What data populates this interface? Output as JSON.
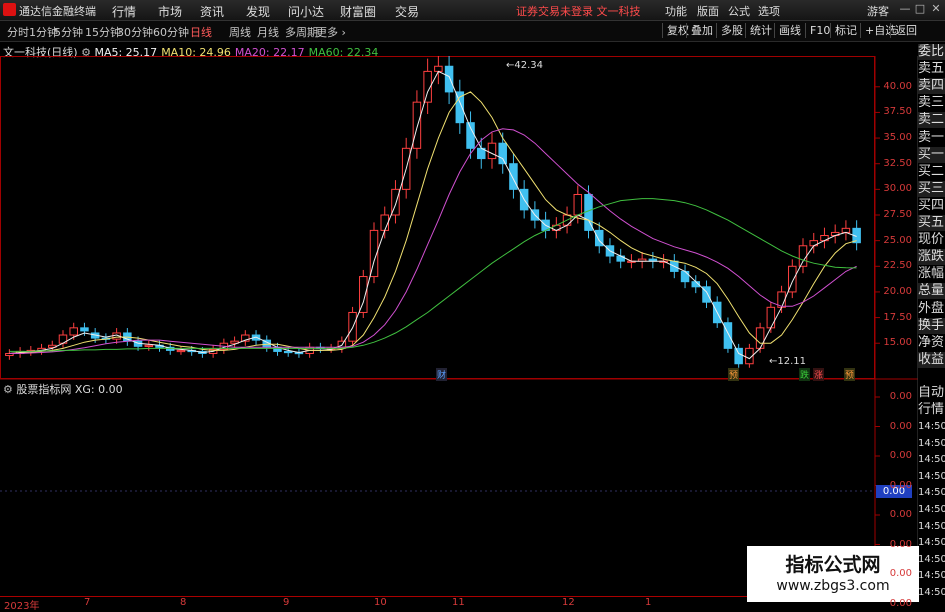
{
  "app": {
    "title": "通达信金融终端",
    "login_warning": "证券交易未登录",
    "stock_name": "文一科技",
    "menu": [
      "行情",
      "市场",
      "资讯",
      "发现",
      "问小达",
      "财富圈",
      "交易"
    ],
    "right_menu": [
      "功能",
      "版面",
      "公式",
      "选项"
    ],
    "guest": "游客",
    "window_buttons": [
      "—",
      "□",
      "✕"
    ]
  },
  "toolbar": {
    "periods": [
      {
        "label": "分时",
        "active": false
      },
      {
        "label": "1分钟",
        "active": false
      },
      {
        "label": "5分钟",
        "active": false
      },
      {
        "label": "15分钟",
        "active": false
      },
      {
        "label": "30分钟",
        "active": false
      },
      {
        "label": "60分钟",
        "active": false
      },
      {
        "label": "日线",
        "active": true
      },
      {
        "label": "周线",
        "active": false
      },
      {
        "label": "月线",
        "active": false
      },
      {
        "label": "多周期",
        "active": false
      },
      {
        "label": "更多 ›",
        "active": false
      }
    ],
    "right_tools": [
      "复权",
      "叠加",
      "多股",
      "统计",
      "画线",
      "F10",
      "标记",
      "+自选",
      "返回"
    ]
  },
  "main_chart": {
    "title": "文一科技(日线)",
    "ma": [
      {
        "label": "MA5: 25.17",
        "color": "#f0f0f0"
      },
      {
        "label": "MA10: 24.96",
        "color": "#f0e070"
      },
      {
        "label": "MA20: 22.17",
        "color": "#d050d0"
      },
      {
        "label": "MA60: 22.34",
        "color": "#40c040"
      }
    ],
    "y_ticks": [
      "40.00",
      "37.50",
      "35.00",
      "32.50",
      "30.00",
      "27.50",
      "25.00",
      "22.50",
      "20.00",
      "17.50",
      "15.00"
    ],
    "high_label": "42.34",
    "low_label": "12.11",
    "events": [
      {
        "label": "财",
        "color": "#5aa0ff"
      },
      {
        "label": "预",
        "color": "#ff9a3a"
      },
      {
        "label": "跌",
        "color": "#3ad03a"
      },
      {
        "label": "涨",
        "color": "#ff5050"
      },
      {
        "label": "预",
        "color": "#ff9a3a"
      }
    ]
  },
  "sub_chart": {
    "title": "股票指标网",
    "xg_label": "XG: 0.00",
    "y_ticks": [
      "0.00",
      "0.00",
      "0.00",
      "0.00",
      "0.00",
      "0.00",
      "0.00",
      "0.00"
    ],
    "current": "0.00"
  },
  "right_panel": {
    "items": [
      "委比",
      "卖五",
      "卖四",
      "卖三",
      "卖二",
      "卖一",
      "买一",
      "买二",
      "买三",
      "买四",
      "买五",
      "现价",
      "涨跌",
      "涨幅",
      "总量",
      "外盘",
      "换手",
      "净资",
      "收益"
    ],
    "auto_label": "自动",
    "quote_label": "行情",
    "times": [
      "14:50",
      "14:50",
      "14:50",
      "14:50",
      "14:50",
      "14:50",
      "14:50",
      "14:50",
      "14:50",
      "14:50",
      "14:50"
    ]
  },
  "x_axis": {
    "labels": [
      "2023年",
      "7",
      "8",
      "9",
      "10",
      "11",
      "12",
      "1"
    ]
  },
  "watermark": {
    "title": "指标公式网",
    "url": "www.zbgs3.com"
  },
  "colors": {
    "up": "#ff4040",
    "down": "#40c0f0",
    "ma5": "#f0f0f0",
    "ma10": "#f0e070",
    "ma20": "#d050d0",
    "ma60": "#40c040",
    "axis": "#a00000"
  },
  "chart_data": {
    "type": "candlestick",
    "title": "文一科技(日线)",
    "y_range": [
      12.0,
      43.0
    ],
    "series": [
      {
        "name": "MA5",
        "values": [
          14.0,
          14.1,
          14.2,
          14.3,
          14.5,
          15.0,
          15.6,
          16.0,
          15.8,
          15.6,
          15.8,
          15.4,
          15.0,
          14.9,
          14.8,
          14.5,
          14.4,
          14.3,
          14.1,
          14.2,
          14.6,
          14.9,
          15.3,
          15.6,
          15.1,
          14.6,
          14.3,
          14.1,
          14.3,
          14.3,
          14.4,
          14.8,
          16.5,
          19.0,
          23.0,
          26.0,
          28.5,
          32.0,
          36.0,
          39.5,
          41.5,
          41.0,
          38.5,
          36.0,
          34.0,
          33.5,
          33.0,
          31.0,
          29.0,
          27.5,
          26.5,
          26.0,
          26.5,
          27.5,
          27.0,
          25.0,
          24.0,
          23.5,
          23.0,
          23.0,
          23.0,
          23.0,
          22.5,
          22.0,
          21.0,
          20.0,
          18.0,
          16.0,
          14.0,
          13.5,
          14.5,
          16.5,
          18.5,
          21.0,
          23.0,
          24.5,
          25.0,
          25.5,
          25.8,
          25.4
        ]
      },
      {
        "name": "MA10",
        "values": [
          14.0,
          14.05,
          14.1,
          14.2,
          14.3,
          14.5,
          14.8,
          15.1,
          15.3,
          15.4,
          15.6,
          15.6,
          15.5,
          15.3,
          15.1,
          14.9,
          14.7,
          14.6,
          14.4,
          14.3,
          14.3,
          14.4,
          14.6,
          14.8,
          14.9,
          14.9,
          14.7,
          14.5,
          14.3,
          14.3,
          14.3,
          14.4,
          14.8,
          15.8,
          17.5,
          19.5,
          22.0,
          25.0,
          28.5,
          32.0,
          35.0,
          37.5,
          39.0,
          39.5,
          38.5,
          37.0,
          35.0,
          33.5,
          32.0,
          30.5,
          29.0,
          28.0,
          27.5,
          27.2,
          27.0,
          26.5,
          25.8,
          25.0,
          24.3,
          23.8,
          23.5,
          23.2,
          23.0,
          22.8,
          22.4,
          21.8,
          20.8,
          19.3,
          17.6,
          16.0,
          15.0,
          15.0,
          15.8,
          17.3,
          19.0,
          20.8,
          22.5,
          23.8,
          24.7,
          25.0
        ]
      },
      {
        "name": "MA20",
        "values": [
          14.0,
          14.0,
          14.05,
          14.1,
          14.15,
          14.25,
          14.4,
          14.55,
          14.75,
          14.95,
          15.1,
          15.2,
          15.3,
          15.3,
          15.3,
          15.2,
          15.1,
          15.0,
          14.9,
          14.8,
          14.7,
          14.6,
          14.6,
          14.6,
          14.6,
          14.6,
          14.6,
          14.6,
          14.6,
          14.6,
          14.6,
          14.6,
          14.7,
          15.1,
          15.8,
          16.8,
          18.2,
          20.0,
          22.2,
          24.6,
          27.0,
          29.5,
          31.7,
          33.5,
          34.8,
          35.6,
          35.9,
          35.8,
          35.3,
          34.5,
          33.5,
          32.5,
          31.5,
          30.5,
          29.7,
          28.8,
          27.9,
          27.1,
          26.4,
          25.8,
          25.2,
          24.8,
          24.4,
          24.1,
          23.8,
          23.4,
          22.9,
          22.3,
          21.5,
          20.6,
          19.7,
          19.0,
          18.6,
          18.6,
          19.0,
          19.6,
          20.4,
          21.2,
          22.0,
          22.5
        ]
      },
      {
        "name": "MA60",
        "values": [
          14.2,
          14.2,
          14.2,
          14.25,
          14.25,
          14.3,
          14.3,
          14.35,
          14.35,
          14.4,
          14.4,
          14.45,
          14.45,
          14.5,
          14.5,
          14.5,
          14.5,
          14.5,
          14.5,
          14.5,
          14.5,
          14.5,
          14.5,
          14.5,
          14.5,
          14.5,
          14.5,
          14.5,
          14.5,
          14.5,
          14.5,
          14.5,
          14.6,
          14.8,
          15.1,
          15.5,
          16.0,
          16.6,
          17.3,
          18.0,
          18.8,
          19.6,
          20.4,
          21.2,
          22.0,
          22.8,
          23.5,
          24.2,
          24.9,
          25.5,
          26.0,
          26.5,
          27.0,
          27.5,
          27.9,
          28.3,
          28.6,
          28.9,
          29.0,
          29.1,
          29.1,
          29.0,
          28.9,
          28.7,
          28.4,
          28.0,
          27.5,
          27.0,
          26.4,
          25.8,
          25.2,
          24.6,
          24.0,
          23.5,
          23.1,
          22.8,
          22.6,
          22.4,
          22.35,
          22.34
        ]
      }
    ],
    "close": [
      14.0,
      14.2,
      14.3,
      14.5,
      14.8,
      15.8,
      16.5,
      16.2,
      15.5,
      15.4,
      16.0,
      15.2,
      14.7,
      14.8,
      14.6,
      14.3,
      14.3,
      14.2,
      14.0,
      14.4,
      15.0,
      15.2,
      15.8,
      15.3,
      14.6,
      14.2,
      14.1,
      14.0,
      14.6,
      14.5,
      14.5,
      15.2,
      18.0,
      21.5,
      26.0,
      27.5,
      30.0,
      34.0,
      38.5,
      41.5,
      42.0,
      39.5,
      36.5,
      34.0,
      33.0,
      34.5,
      32.5,
      30.0,
      28.0,
      27.0,
      26.0,
      26.5,
      27.5,
      29.5,
      26.0,
      24.5,
      23.5,
      23.0,
      23.0,
      23.2,
      23.0,
      23.0,
      22.0,
      21.0,
      20.5,
      19.0,
      17.0,
      14.5,
      13.0,
      14.5,
      16.5,
      18.5,
      20.0,
      22.5,
      24.5,
      25.0,
      25.5,
      25.8,
      26.2,
      24.8
    ],
    "open": [
      13.8,
      14.0,
      14.2,
      14.3,
      14.6,
      15.0,
      15.8,
      16.5,
      16.0,
      15.5,
      15.4,
      16.0,
      15.2,
      14.7,
      14.8,
      14.6,
      14.3,
      14.3,
      14.2,
      14.0,
      14.4,
      15.0,
      15.2,
      15.8,
      15.3,
      14.6,
      14.2,
      14.1,
      14.0,
      14.6,
      14.5,
      14.5,
      15.2,
      18.0,
      21.5,
      26.0,
      27.5,
      30.0,
      34.0,
      38.5,
      41.5,
      42.0,
      39.5,
      36.5,
      34.0,
      33.0,
      34.5,
      32.5,
      30.0,
      28.0,
      27.0,
      26.0,
      26.5,
      27.5,
      29.5,
      26.0,
      24.5,
      23.5,
      23.0,
      23.0,
      23.2,
      23.0,
      23.0,
      22.0,
      21.0,
      20.5,
      19.0,
      17.0,
      14.5,
      13.0,
      14.5,
      16.5,
      18.5,
      20.0,
      22.5,
      24.5,
      25.0,
      25.5,
      25.8,
      26.2
    ]
  }
}
